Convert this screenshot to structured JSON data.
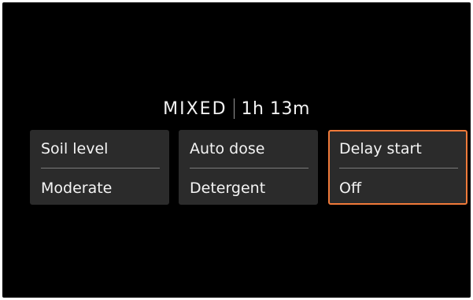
{
  "status": {
    "cycle": "MIXED",
    "time_remaining": "1h 13m"
  },
  "options": [
    {
      "title": "Soil level",
      "value": "Moderate",
      "selected": false
    },
    {
      "title": "Auto dose",
      "value": "Detergent",
      "selected": false
    },
    {
      "title": "Delay start",
      "value": "Off",
      "selected": true
    }
  ],
  "colors": {
    "background": "#000000",
    "card": "#2b2b2b",
    "selection_border": "#f07a3a",
    "text": "#f4f4f4"
  }
}
